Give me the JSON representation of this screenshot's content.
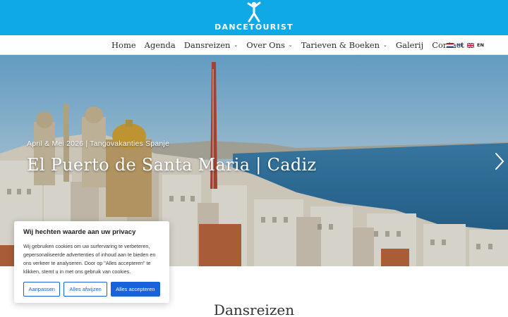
{
  "brand": {
    "name": "DANCETOURIST",
    "icon": "dancing-figure-icon",
    "bar_color": "#10a9e8"
  },
  "nav": {
    "items": [
      {
        "label": "Home",
        "has_dropdown": false
      },
      {
        "label": "Agenda",
        "has_dropdown": false
      },
      {
        "label": "Dansreizen",
        "has_dropdown": true
      },
      {
        "label": "Over Ons",
        "has_dropdown": true
      },
      {
        "label": "Tarieven & Boeken",
        "has_dropdown": true
      },
      {
        "label": "Galerij",
        "has_dropdown": false
      },
      {
        "label": "Contact",
        "has_dropdown": true
      }
    ],
    "chevron": "⌄",
    "languages": [
      {
        "code": "NL",
        "flag": "nl-flag-icon",
        "active": true
      },
      {
        "code": "EN",
        "flag": "uk-flag-icon",
        "active": false
      }
    ]
  },
  "hero": {
    "meta": "April & Mei 2026 | Tangovakanties Spanje",
    "title": "El Puerto de Santa Maria | Cadiz",
    "next_icon": "chevron-right-icon"
  },
  "section": {
    "title": "Dansreizen"
  },
  "cookie": {
    "title": "Wij hechten waarde aan uw privacy",
    "text": "Wij gebruiken cookies om uw surfervaring te verbeteren, gepersonaliseerde advertenties of inhoud aan te bieden en ons verkeer te analyseren. Door op \"Alles accepteren\" te klikken, stemt u in met ons gebruik van cookies.",
    "buttons": {
      "customize": "Aanpassen",
      "reject": "Alles afwijzen",
      "accept": "Alles accepteren"
    },
    "accent_color": "#1863dc"
  }
}
